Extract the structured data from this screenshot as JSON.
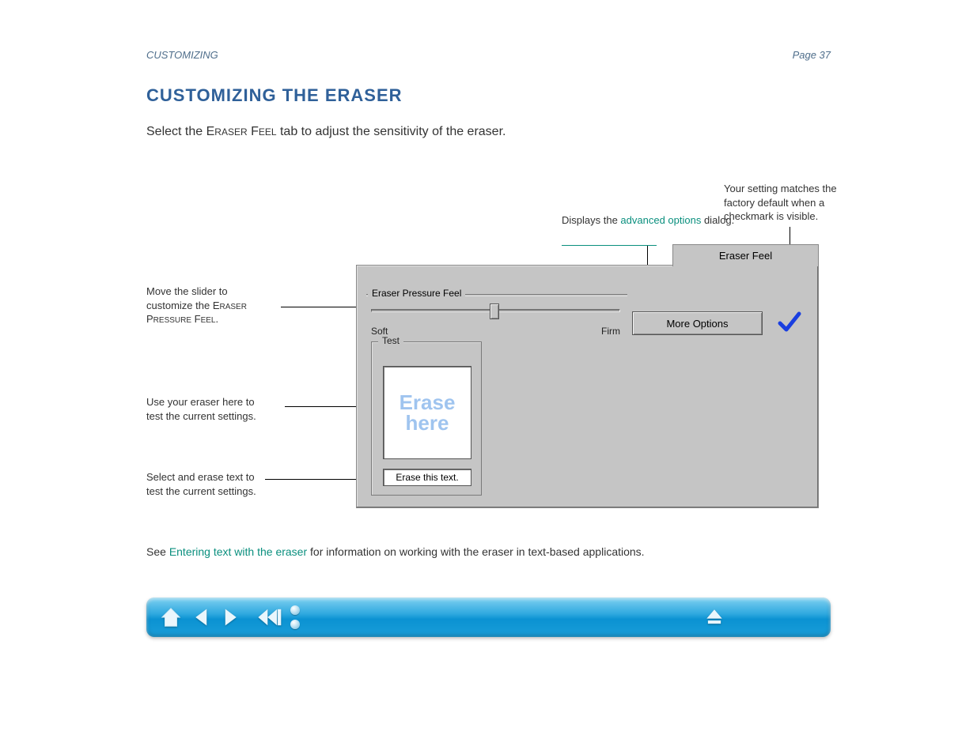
{
  "page": {
    "headerLeft": "CUSTOMIZING",
    "headerRight": "Page 37",
    "mainTitle": "CUSTOMIZING THE ERASER",
    "body_prefix": "Select the E",
    "body_mid1": "RASER",
    "body_mid2": " F",
    "body_mid3": "EEL",
    "body_suffix": " tab to adjust the sensitivity of the eraser.",
    "footnote_part1": "See ",
    "footnote_link": "Entering text with the eraser",
    "footnote_part2": " for information on working with the eraser in text-based applications."
  },
  "dialog": {
    "tabLabel": "Eraser Feel",
    "grpPressureLabel": "Eraser Pressure Feel",
    "sliderMin": "Soft",
    "sliderMax": "Firm",
    "moreOptions": "More Options",
    "grpTestLabel": "Test",
    "testCanvasLine1": "Erase",
    "testCanvasLine2": "here",
    "testInputValue": "Erase this text."
  },
  "callouts": {
    "c_slider_line1": "Move the slider to",
    "c_slider_line2": "customize the E",
    "c_slider_line2_small": "RASER",
    "c_slider_line3_pre": "P",
    "c_slider_line3_small1": "RESSURE",
    "c_slider_line3_mid": " F",
    "c_slider_line3_small2": "EEL",
    "c_slider_line3_end": ".",
    "c_moreoptions": "Displays the ",
    "c_moreoptions_link": "advanced options",
    "c_moreoptions_end": " dialog.",
    "c_check_line1": "Your setting matches the",
    "c_check_line2": "factory default when a",
    "c_check_line3": "checkmark is visible.",
    "c_testcanvas_line1": "Use your eraser here to",
    "c_testcanvas_line2": "test the current settings.",
    "c_testinput_line1": "Select and erase text to",
    "c_testinput_line2": "test the current settings."
  },
  "nav": {
    "home": "home-icon",
    "back": "back-icon",
    "forward": "forward-icon",
    "prev_section": "prev-section-icon",
    "dots": "view-dots",
    "eject": "eject-icon"
  }
}
